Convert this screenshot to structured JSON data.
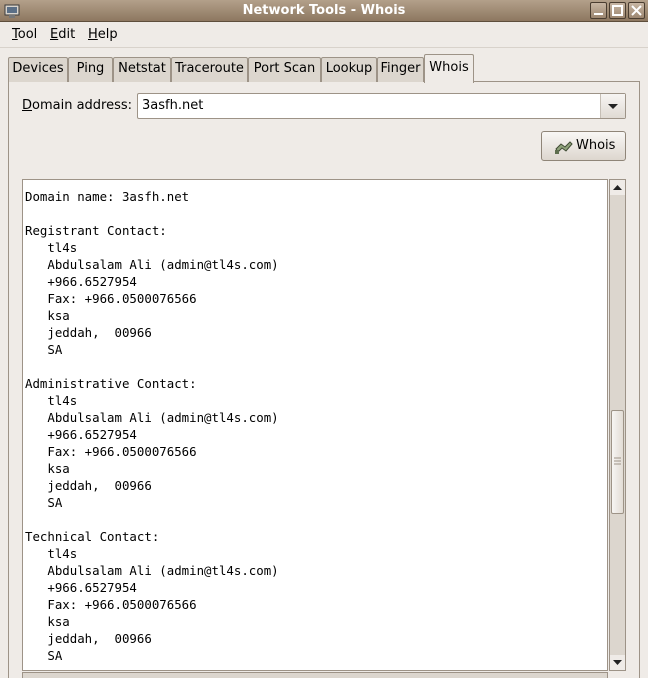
{
  "window": {
    "title": "Network Tools - Whois"
  },
  "menu": [
    {
      "label": "Tool",
      "mnemonic": "T",
      "rest": "ool"
    },
    {
      "label": "Edit",
      "mnemonic": "E",
      "rest": "dit"
    },
    {
      "label": "Help",
      "mnemonic": "H",
      "rest": "elp"
    }
  ],
  "tabs": [
    "Devices",
    "Ping",
    "Netstat",
    "Traceroute",
    "Port Scan",
    "Lookup",
    "Finger",
    "Whois"
  ],
  "active_tab": "Whois",
  "domain": {
    "label_mnemonic": "D",
    "label_rest": "omain address:",
    "value": "3asfh.net"
  },
  "whois_button": {
    "label": "Whois"
  },
  "output": {
    "lines": [
      "Domain name: 3asfh.net",
      "",
      "Registrant Contact:",
      "   tl4s",
      "   Abdulsalam Ali (admin@tl4s.com)",
      "   +966.6527954",
      "   Fax: +966.0500076566",
      "   ksa",
      "   jeddah,  00966",
      "   SA",
      "",
      "Administrative Contact:",
      "   tl4s",
      "   Abdulsalam Ali (admin@tl4s.com)",
      "   +966.6527954",
      "   Fax: +966.0500076566",
      "   ksa",
      "   jeddah,  00966",
      "   SA",
      "",
      "Technical Contact:",
      "   tl4s",
      "   Abdulsalam Ali (admin@tl4s.com)",
      "   +966.6527954",
      "   Fax: +966.0500076566",
      "   ksa",
      "   jeddah,  00966",
      "   SA"
    ]
  },
  "icons": {
    "app": "network-tools-icon",
    "minimize": "minimize-icon",
    "maximize": "maximize-icon",
    "close": "close-icon",
    "dropdown": "chevron-down-icon",
    "whois": "handshake-icon"
  },
  "colors": {
    "titlebar": "#9c8670",
    "panel": "#efebe7"
  }
}
